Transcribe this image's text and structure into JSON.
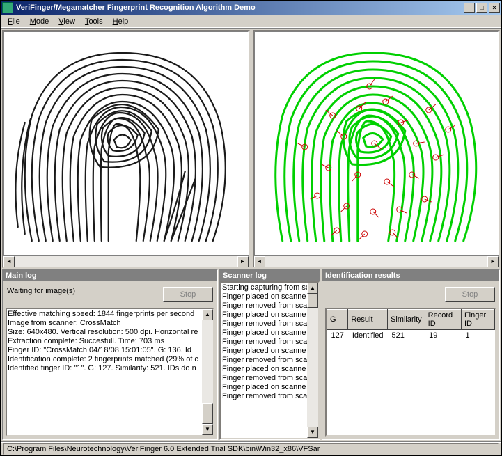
{
  "window": {
    "title": "VeriFinger/Megamatcher Fingerprint Recognition Algorithm Demo",
    "minimize": "_",
    "maximize": "□",
    "close": "×"
  },
  "menu": {
    "file": "File",
    "mode": "Mode",
    "view": "View",
    "tools": "Tools",
    "help": "Help"
  },
  "sections": {
    "main_log": "Main log",
    "scanner_log": "Scanner log",
    "identification_results": "Identification results"
  },
  "main_log": {
    "waiting": "Waiting for image(s)",
    "stop": "Stop",
    "lines": [
      "Effective matching speed: 1844 fingerprints per second",
      "",
      "Image from scanner: CrossMatch",
      "Size: 640x480. Vertical resolution: 500 dpi. Horizontal re",
      "Extraction complete: Succesfull. Time: 703 ms",
      "Finger ID: \"CrossMatch 04/18/08 15:01:05\". G: 136. Id",
      "Identification complete: 2 fingerprints matched (29% of c",
      "Identified finger ID: \"1\". G: 127. Similarity: 521. IDs do n"
    ]
  },
  "scanner_log": {
    "lines": [
      "Starting capturing from sc",
      "Finger placed on scanne",
      "Finger removed from scar",
      "Finger placed on scanne",
      "Finger removed from scar",
      "Finger placed on scanne",
      "Finger removed from scar",
      "Finger placed on scanne",
      "Finger removed from scar",
      "Finger placed on scanne",
      "Finger removed from scar",
      "Finger placed on scanne",
      "Finger removed from scar"
    ]
  },
  "identification": {
    "stop": "Stop",
    "columns": [
      "G",
      "Result",
      "Similarity",
      "Record ID",
      "Finger ID"
    ],
    "rows": [
      {
        "g": "127",
        "result": "Identified",
        "similarity": "521",
        "record_id": "19",
        "finger_id": "1"
      }
    ]
  },
  "status": {
    "path": "C:\\Program Files\\Neurotechnology\\VeriFinger 6.0 Extended Trial SDK\\bin\\Win32_x86\\VFSar"
  }
}
